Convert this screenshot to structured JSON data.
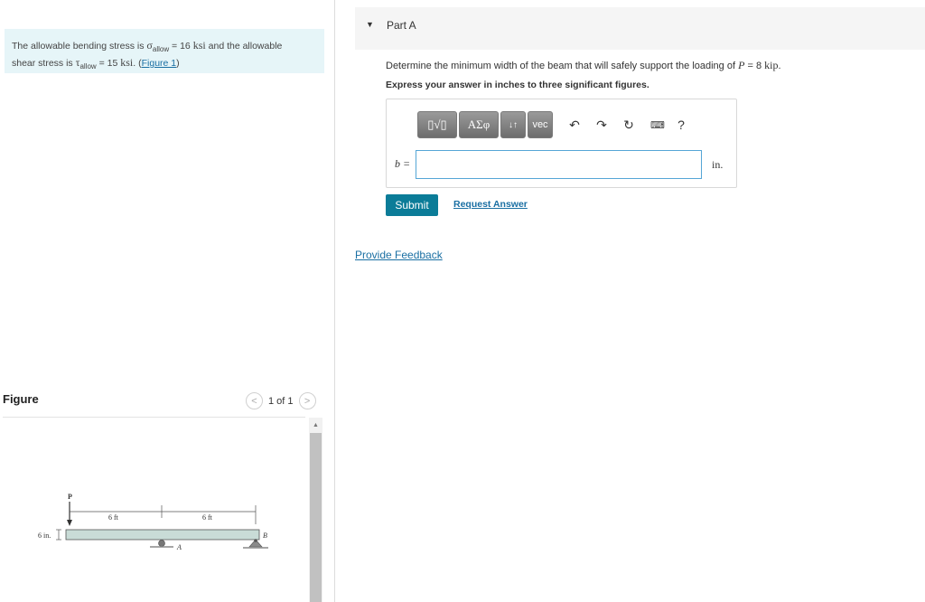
{
  "problem": {
    "text_1": "The allowable bending stress is ",
    "sigma_sym": "σ",
    "sigma_sub": "allow",
    "text_2": " = 16 ",
    "unit_1": "ksi",
    "text_3": " and the allowable",
    "text_4": "shear stress is ",
    "tau_sym": "τ",
    "tau_sub": "allow",
    "text_5": " = 15 ",
    "unit_2": "ksi",
    "text_6": ". (",
    "figure_link": "Figure 1",
    "text_7": ")"
  },
  "figure": {
    "title": "Figure",
    "page_indicator": "1 of 1",
    "prev_symbol": "<",
    "next_symbol": ">",
    "load_label": "P",
    "dim_left": "6 ft",
    "dim_right": "6 ft",
    "depth_label": "6 in.",
    "support_a": "A",
    "support_b": "B"
  },
  "part": {
    "title": "Part A",
    "question_1": "Determine the minimum width of the beam that will safely support the loading of ",
    "question_var": "P",
    "question_2": " = 8 ",
    "question_unit": "kip",
    "question_3": ".",
    "instruction": "Express your answer in inches to three significant figures."
  },
  "answer": {
    "var_label": "b =",
    "value": "",
    "unit": "in.",
    "toolbar": {
      "templates_label": "▯√▯",
      "greek_label": "ΑΣφ",
      "arrows_label": "↓↑",
      "vec_label": "vec",
      "help_label": "?"
    }
  },
  "actions": {
    "submit": "Submit",
    "request_answer": "Request Answer",
    "feedback": "Provide Feedback"
  }
}
